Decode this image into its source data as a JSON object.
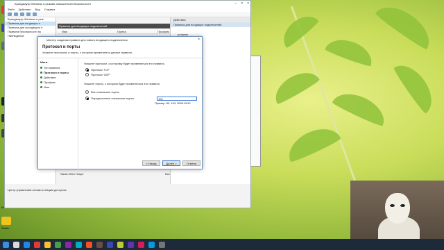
{
  "mmc": {
    "title": "Брандмауэр Windows в режиме повышенной безопасности",
    "menu": [
      "Файл",
      "Действие",
      "Вид",
      "Справка"
    ],
    "tree": [
      "Брандмауэр Windows в реж",
      "Правила для входящих п",
      "Правила для исходящего п",
      "Правила безопасности по",
      "Наблюдение"
    ],
    "center_header": "Правила для входящих подключений",
    "col_name": "Имя",
    "col_group": "Группа",
    "col_profile": "Профиль",
    "steam_row": "Steam Web Helper",
    "steam_row_val": "Все",
    "actions_header": "Действия",
    "actions_sub": "Правила для входящих подключений",
    "actions_items": [
      "…",
      "рофилю",
      "стоянию",
      "уппе",
      "…",
      "…"
    ],
    "status_desc": "Центр управления сетями и общим доступом"
  },
  "wizard": {
    "title": "Мастер создания правила для нового входящего подключения",
    "heading": "Протокол и порты",
    "subheading": "Укажите протоколы и порты, к которым применяется данное правило.",
    "steps_title": "Шаги:",
    "steps": [
      "Тип правила",
      "Протокол и порты",
      "Действие",
      "Профиль",
      "Имя"
    ],
    "q_protocol": "Укажите протокол, к которому будет применяться это правило.",
    "opt_tcp": "Протокол TCP",
    "opt_udp": "Протокол UDP",
    "q_ports": "Укажите порты, к которым будет применяться это правило.",
    "opt_all_ports": "Все локальные порты",
    "opt_specific_ports": "Определенные локальные порты:",
    "ports_value": "102",
    "ports_hint": "Пример: 80, 443, 5000-5010",
    "btn_back": "< Назад",
    "btn_next": "Далее >",
    "btn_cancel": "Отмена"
  },
  "desktop": {
    "labels": [
      "Media",
      "Studio"
    ]
  }
}
